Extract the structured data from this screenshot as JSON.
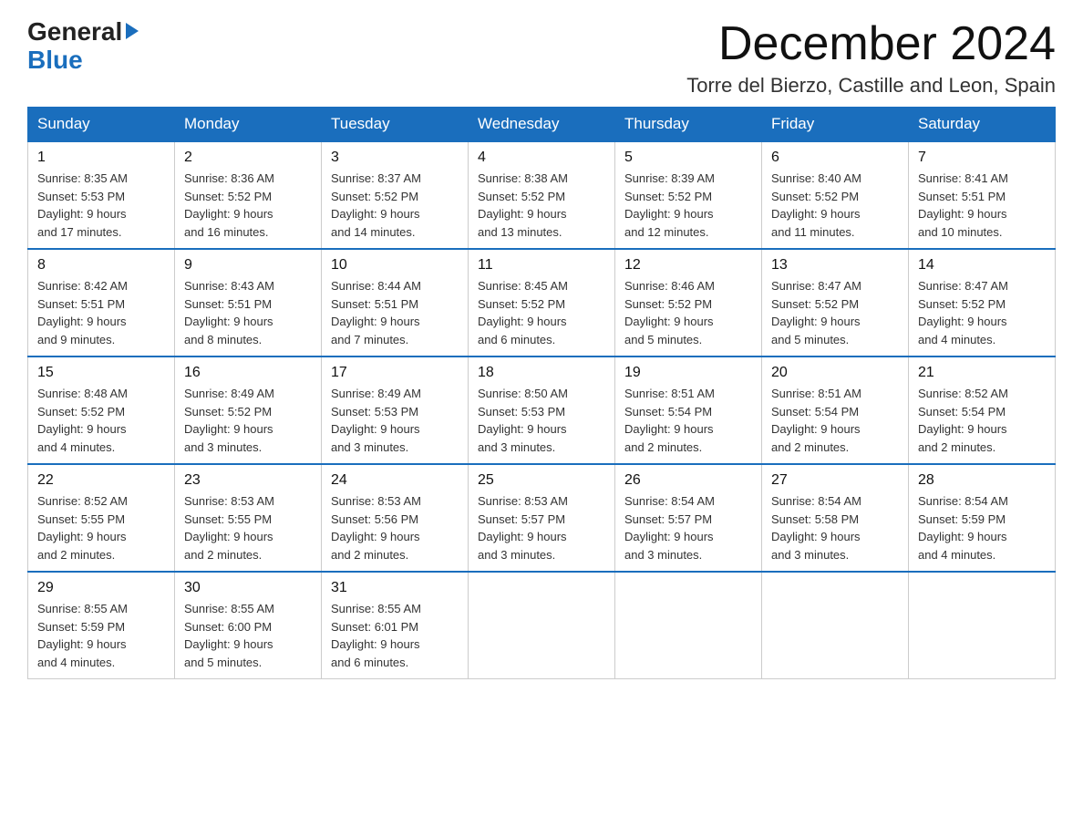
{
  "header": {
    "month_title": "December 2024",
    "location": "Torre del Bierzo, Castille and Leon, Spain",
    "logo_general": "General",
    "logo_blue": "Blue"
  },
  "weekdays": [
    "Sunday",
    "Monday",
    "Tuesday",
    "Wednesday",
    "Thursday",
    "Friday",
    "Saturday"
  ],
  "weeks": [
    [
      {
        "day": "1",
        "sunrise": "8:35 AM",
        "sunset": "5:53 PM",
        "daylight": "9 hours and 17 minutes."
      },
      {
        "day": "2",
        "sunrise": "8:36 AM",
        "sunset": "5:52 PM",
        "daylight": "9 hours and 16 minutes."
      },
      {
        "day": "3",
        "sunrise": "8:37 AM",
        "sunset": "5:52 PM",
        "daylight": "9 hours and 14 minutes."
      },
      {
        "day": "4",
        "sunrise": "8:38 AM",
        "sunset": "5:52 PM",
        "daylight": "9 hours and 13 minutes."
      },
      {
        "day": "5",
        "sunrise": "8:39 AM",
        "sunset": "5:52 PM",
        "daylight": "9 hours and 12 minutes."
      },
      {
        "day": "6",
        "sunrise": "8:40 AM",
        "sunset": "5:52 PM",
        "daylight": "9 hours and 11 minutes."
      },
      {
        "day": "7",
        "sunrise": "8:41 AM",
        "sunset": "5:51 PM",
        "daylight": "9 hours and 10 minutes."
      }
    ],
    [
      {
        "day": "8",
        "sunrise": "8:42 AM",
        "sunset": "5:51 PM",
        "daylight": "9 hours and 9 minutes."
      },
      {
        "day": "9",
        "sunrise": "8:43 AM",
        "sunset": "5:51 PM",
        "daylight": "9 hours and 8 minutes."
      },
      {
        "day": "10",
        "sunrise": "8:44 AM",
        "sunset": "5:51 PM",
        "daylight": "9 hours and 7 minutes."
      },
      {
        "day": "11",
        "sunrise": "8:45 AM",
        "sunset": "5:52 PM",
        "daylight": "9 hours and 6 minutes."
      },
      {
        "day": "12",
        "sunrise": "8:46 AM",
        "sunset": "5:52 PM",
        "daylight": "9 hours and 5 minutes."
      },
      {
        "day": "13",
        "sunrise": "8:47 AM",
        "sunset": "5:52 PM",
        "daylight": "9 hours and 5 minutes."
      },
      {
        "day": "14",
        "sunrise": "8:47 AM",
        "sunset": "5:52 PM",
        "daylight": "9 hours and 4 minutes."
      }
    ],
    [
      {
        "day": "15",
        "sunrise": "8:48 AM",
        "sunset": "5:52 PM",
        "daylight": "9 hours and 4 minutes."
      },
      {
        "day": "16",
        "sunrise": "8:49 AM",
        "sunset": "5:52 PM",
        "daylight": "9 hours and 3 minutes."
      },
      {
        "day": "17",
        "sunrise": "8:49 AM",
        "sunset": "5:53 PM",
        "daylight": "9 hours and 3 minutes."
      },
      {
        "day": "18",
        "sunrise": "8:50 AM",
        "sunset": "5:53 PM",
        "daylight": "9 hours and 3 minutes."
      },
      {
        "day": "19",
        "sunrise": "8:51 AM",
        "sunset": "5:54 PM",
        "daylight": "9 hours and 2 minutes."
      },
      {
        "day": "20",
        "sunrise": "8:51 AM",
        "sunset": "5:54 PM",
        "daylight": "9 hours and 2 minutes."
      },
      {
        "day": "21",
        "sunrise": "8:52 AM",
        "sunset": "5:54 PM",
        "daylight": "9 hours and 2 minutes."
      }
    ],
    [
      {
        "day": "22",
        "sunrise": "8:52 AM",
        "sunset": "5:55 PM",
        "daylight": "9 hours and 2 minutes."
      },
      {
        "day": "23",
        "sunrise": "8:53 AM",
        "sunset": "5:55 PM",
        "daylight": "9 hours and 2 minutes."
      },
      {
        "day": "24",
        "sunrise": "8:53 AM",
        "sunset": "5:56 PM",
        "daylight": "9 hours and 2 minutes."
      },
      {
        "day": "25",
        "sunrise": "8:53 AM",
        "sunset": "5:57 PM",
        "daylight": "9 hours and 3 minutes."
      },
      {
        "day": "26",
        "sunrise": "8:54 AM",
        "sunset": "5:57 PM",
        "daylight": "9 hours and 3 minutes."
      },
      {
        "day": "27",
        "sunrise": "8:54 AM",
        "sunset": "5:58 PM",
        "daylight": "9 hours and 3 minutes."
      },
      {
        "day": "28",
        "sunrise": "8:54 AM",
        "sunset": "5:59 PM",
        "daylight": "9 hours and 4 minutes."
      }
    ],
    [
      {
        "day": "29",
        "sunrise": "8:55 AM",
        "sunset": "5:59 PM",
        "daylight": "9 hours and 4 minutes."
      },
      {
        "day": "30",
        "sunrise": "8:55 AM",
        "sunset": "6:00 PM",
        "daylight": "9 hours and 5 minutes."
      },
      {
        "day": "31",
        "sunrise": "8:55 AM",
        "sunset": "6:01 PM",
        "daylight": "9 hours and 6 minutes."
      },
      null,
      null,
      null,
      null
    ]
  ],
  "labels": {
    "sunrise": "Sunrise:",
    "sunset": "Sunset:",
    "daylight": "Daylight:"
  }
}
